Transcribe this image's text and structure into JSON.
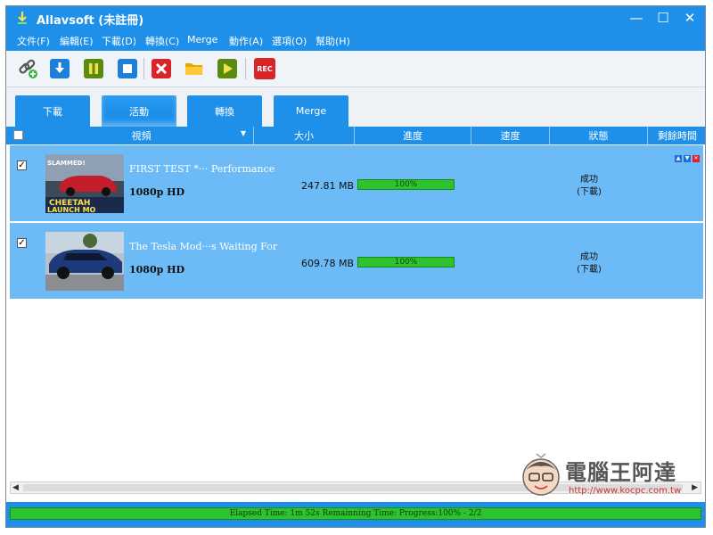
{
  "window": {
    "title": "Allavsoft (未註冊)",
    "minimize": "—",
    "maximize": "☐",
    "close": "✕"
  },
  "menu": [
    "文件(F)",
    "編輯(E)",
    "下載(D)",
    "轉換(C)",
    "Merge",
    "動作(A)",
    "選項(O)",
    "幫助(H)"
  ],
  "toolbar": {
    "rec_label": "REC"
  },
  "tabs": [
    {
      "label": "下載"
    },
    {
      "label": "活動",
      "active": true
    },
    {
      "label": "轉換"
    },
    {
      "label": "Merge"
    }
  ],
  "columns": [
    "視頻",
    "大小",
    "進度",
    "速度",
    "狀態",
    "剩餘時間"
  ],
  "rows": [
    {
      "checked": "✓",
      "title": "FIRST TEST *··· Performance",
      "quality": "1080p HD",
      "size": "247.81 MB",
      "progress": "100%",
      "progress_value": 100,
      "status": "成功",
      "status_sub": "(下載)",
      "thumb_text1": "SLAMMED!",
      "thumb_text2": "CHEETAH",
      "thumb_text3": "LAUNCH MO"
    },
    {
      "checked": "✓",
      "title": "The Tesla Mod···s Waiting For",
      "quality": "1080p HD",
      "size": "609.78 MB",
      "progress": "100%",
      "progress_value": 100,
      "status": "成功",
      "status_sub": "(下載)"
    }
  ],
  "statusbar": {
    "text": "Elapsed Time: 1m 52s Remainning Time: Progress:100% - 2/2"
  },
  "watermark": {
    "text": "電腦王阿達",
    "url": "http://www.kocpc.com.tw"
  },
  "colors": {
    "accent": "#1e90ea",
    "row": "#6cbaf6",
    "progress": "#2ec32e"
  }
}
